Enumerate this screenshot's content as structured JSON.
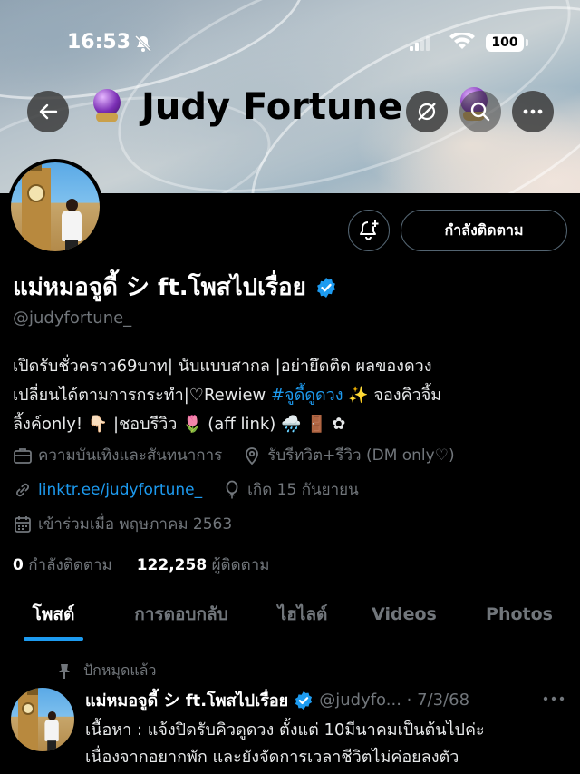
{
  "status_bar": {
    "time": "16:53",
    "battery": "100"
  },
  "header": {
    "title": "Judy Fortune"
  },
  "profile": {
    "display_name": "แม่หมอจูดี้ シ ft.โพสไปเรื่อย",
    "handle": "@judyfortune_",
    "following_button": "กำลังติดตาม",
    "bio_lines": [
      "เปิดรับชั่วคราว69บาท| นับแบบสากล |อย่ายึดติด ผลของดวง",
      "เปลี่ยนได้ตามการกระทำ|♡Rewiew ",
      "ลิ้งค์only! 👇🏻 |ชอบรีวิว 🌷 (aff link) 🌧️ 🚪 ✿"
    ],
    "bio_hashtag": "#จูดี้ดูดวง",
    "bio_line2_tail": " ✨ จองคิวจิ้ม",
    "category": "ความบันเทิงและสันทนาการ",
    "location": "รับรีทวิต+รีวิว (DM only♡)",
    "website": "linktr.ee/judyfortune_",
    "birthday": "เกิด 15 กันยายน",
    "joined": "เข้าร่วมเมื่อ พฤษภาคม 2563",
    "following_count": "0",
    "following_label": "กำลังติดตาม",
    "followers_count": "122,258",
    "followers_label": "ผู้ติดตาม"
  },
  "tabs": [
    {
      "label": "โพสต์",
      "active": true
    },
    {
      "label": "การตอบกลับ",
      "active": false
    },
    {
      "label": "ไฮไลต์",
      "active": false
    },
    {
      "label": "Videos",
      "active": false
    },
    {
      "label": "Photos",
      "active": false
    }
  ],
  "pinned_post": {
    "pinned_label": "ปักหมุดแล้ว",
    "author": "แม่หมอจูดี้ シ ft.โพสไปเรื่อย",
    "handle_date": "@judyfo... · 7/3/68",
    "lines": [
      "เนื้อหา : แจ้งปิดรับคิวดูดวง ตั้งแต่ 10มีนาคมเป็นต้นไปค่ะ",
      "เนื่องจากอยากพัก และยังจัดการเวลาชีวิตไม่ค่อยลงตัว"
    ]
  },
  "colors": {
    "accent": "#1d9bf0",
    "muted": "#71767b",
    "background": "#000000"
  }
}
